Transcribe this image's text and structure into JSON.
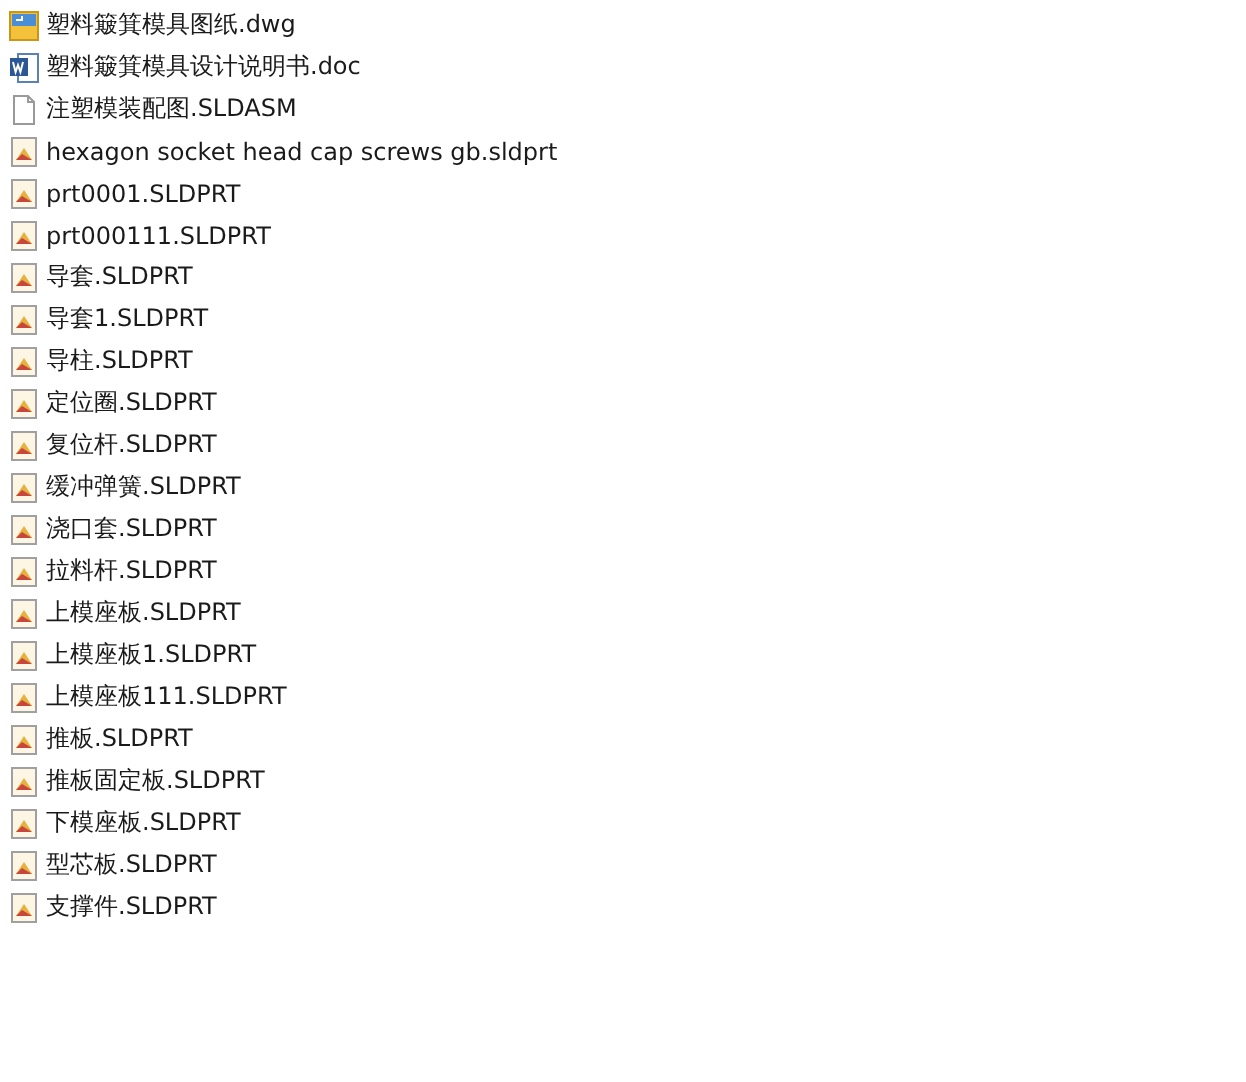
{
  "files": [
    {
      "name": "塑料簸箕模具图纸.dwg",
      "kind": "drawing"
    },
    {
      "name": "塑料簸箕模具设计说明书.doc",
      "kind": "document"
    },
    {
      "name": "注塑模装配图.SLDASM",
      "kind": "blank"
    },
    {
      "name": "hexagon socket head cap screws gb.sldprt",
      "kind": "part"
    },
    {
      "name": "prt0001.SLDPRT",
      "kind": "part"
    },
    {
      "name": "prt000111.SLDPRT",
      "kind": "part"
    },
    {
      "name": "导套.SLDPRT",
      "kind": "part"
    },
    {
      "name": "导套1.SLDPRT",
      "kind": "part"
    },
    {
      "name": "导柱.SLDPRT",
      "kind": "part"
    },
    {
      "name": "定位圈.SLDPRT",
      "kind": "part"
    },
    {
      "name": "复位杆.SLDPRT",
      "kind": "part"
    },
    {
      "name": "缓冲弹簧.SLDPRT",
      "kind": "part"
    },
    {
      "name": "浇口套.SLDPRT",
      "kind": "part"
    },
    {
      "name": "拉料杆.SLDPRT",
      "kind": "part"
    },
    {
      "name": "上模座板.SLDPRT",
      "kind": "part"
    },
    {
      "name": "上模座板1.SLDPRT",
      "kind": "part"
    },
    {
      "name": "上模座板111.SLDPRT",
      "kind": "part"
    },
    {
      "name": "推板.SLDPRT",
      "kind": "part"
    },
    {
      "name": "推板固定板.SLDPRT",
      "kind": "part"
    },
    {
      "name": "下模座板.SLDPRT",
      "kind": "part"
    },
    {
      "name": "型芯板.SLDPRT",
      "kind": "part"
    },
    {
      "name": "支撑件.SLDPRT",
      "kind": "part"
    }
  ]
}
